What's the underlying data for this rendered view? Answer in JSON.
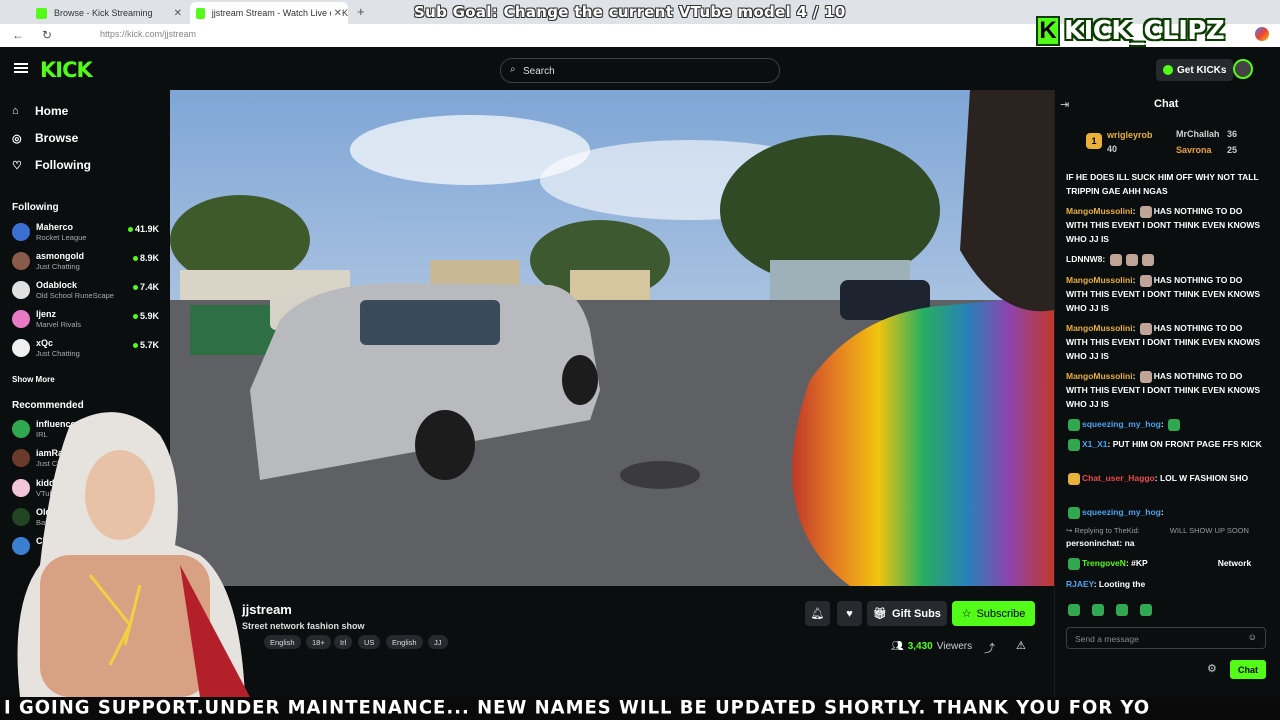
{
  "browser": {
    "tabs": [
      {
        "title": "Browse - Kick Streaming",
        "active": false
      },
      {
        "title": "jjstream Stream - Watch Live on K",
        "active": true
      }
    ],
    "url": "https://kick.com/jjstream"
  },
  "overlay": {
    "sub_goal": "Sub Goal: Change the current VTube model  4 / 10",
    "brand": "KICK_CLIPZ",
    "ticker": "I GOING SUPPORT.UNDER MAINTENANCE... NEW NAMES WILL BE UPDATED SHORTLY. THANK YOU FOR YO"
  },
  "header": {
    "logo": "KICK",
    "search_placeholder": "Search",
    "get_kicks": "Get KICKs"
  },
  "sidebar": {
    "nav": [
      {
        "label": "Home",
        "icon": "home-icon"
      },
      {
        "label": "Browse",
        "icon": "compass-icon"
      },
      {
        "label": "Following",
        "icon": "heart-icon"
      }
    ],
    "following_title": "Following",
    "following": [
      {
        "name": "Maherco",
        "category": "Rocket League",
        "viewers": "41.9K",
        "color": "#3b6fd4"
      },
      {
        "name": "asmongold",
        "category": "Just Chatting",
        "viewers": "8.9K",
        "color": "#8a5a4a"
      },
      {
        "name": "Odablock",
        "category": "Old School RuneScape",
        "viewers": "7.4K",
        "color": "#e0e0e0"
      },
      {
        "name": "ljenz",
        "category": "Marvel Rivals",
        "viewers": "5.9K",
        "color": "#e879c4"
      },
      {
        "name": "xQc",
        "category": "Just Chatting",
        "viewers": "5.7K",
        "color": "#f0f0f0"
      }
    ],
    "show_more": "Show More",
    "recommended_title": "Recommended",
    "recommended": [
      {
        "name": "influencerci",
        "category": "IRL",
        "color": "#2fa84f"
      },
      {
        "name": "iamRa",
        "category": "Just Chat",
        "color": "#6a3a2a"
      },
      {
        "name": "kiddlynx",
        "category": "VTubers",
        "color": "#f2c6d8"
      },
      {
        "name": "Oldpee",
        "category": "Battl",
        "color": "#224422"
      },
      {
        "name": "Class",
        "category": "",
        "color": "#3a7fd0"
      }
    ]
  },
  "stream": {
    "streamer": "jjstream",
    "title": "Street network fashion show",
    "tags": [
      "English",
      "18+",
      "Irl",
      "US",
      "English",
      "JJ"
    ],
    "gift_subs": "Gift Subs",
    "subscribe": "Subscribe",
    "viewers": "3,430",
    "viewers_label": "Viewers"
  },
  "chat": {
    "title": "Chat",
    "leaderboard": [
      {
        "name": "wrigleyrob",
        "count": "40",
        "color": "#e8b13a"
      },
      {
        "name": "MrChallah",
        "count": "36",
        "color": "#d0d0d0"
      },
      {
        "name": "Savrona",
        "count": "25",
        "color": "#e8a13a"
      }
    ],
    "messages": [
      {
        "user": "",
        "text": "IF HE DOES ILL SUCK HIM OFF WHY NOT TALL TRIPPIN GAE AHH NGAS",
        "color": "#fff"
      },
      {
        "user": "MangoMussolini",
        "text": "HAS NOTHING TO DO WITH THIS EVENT I DONT THINK EVEN KNOWS WHO JJ IS",
        "color": "#e8b13a"
      },
      {
        "user": "LDNNW8",
        "text": "",
        "color": "#ffffff"
      },
      {
        "user": "MangoMussolini",
        "text": "HAS NOTHING TO DO WITH THIS EVENT I DONT THINK EVEN KNOWS WHO JJ IS",
        "color": "#e8b13a"
      },
      {
        "user": "MangoMussolini",
        "text": "HAS NOTHING TO DO WITH THIS EVENT I DONT THINK EVEN KNOWS WHO JJ IS",
        "color": "#e8b13a"
      },
      {
        "user": "MangoMussolini",
        "text": "HAS NOTHING TO DO WITH THIS EVENT I DONT THINK EVEN KNOWS WHO JJ IS",
        "color": "#e8b13a"
      },
      {
        "user": "squeezing_my_hog",
        "text": "",
        "color": "#4aa3f0"
      },
      {
        "user": "X1_X1",
        "text": "PUT HIM ON FRONT PAGE FFS KICK",
        "color": "#4aa3f0"
      },
      {
        "user": "Chat_user_Haggo",
        "text": "LOL W FASHION SHO",
        "color": "#e84a4a"
      },
      {
        "user": "squeezing_my_hog",
        "text": "",
        "color": "#4aa3f0"
      },
      {
        "user": "personinchat",
        "text": "na",
        "color": "#ffffff"
      },
      {
        "user": "TrengoveN",
        "text": "#KP",
        "color": "#53fc18"
      },
      {
        "user": "RJAEY",
        "text": "Looting the",
        "color": "#4aa3f0"
      }
    ],
    "reply_note": "Replying to TheKid:",
    "reply_snippet": "WILL SHOW UP SOON",
    "network_fragment": "Network",
    "input_placeholder": "Send a message",
    "send_label": "Chat"
  }
}
